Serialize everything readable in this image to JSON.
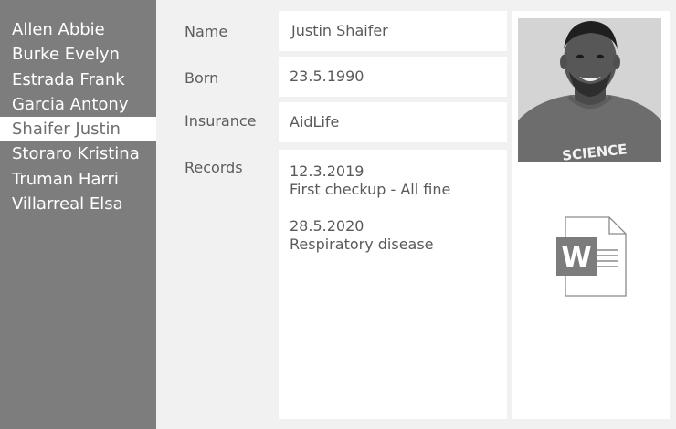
{
  "patients": [
    {
      "name": "Allen Abbie",
      "selected": false
    },
    {
      "name": "Burke Evelyn",
      "selected": false
    },
    {
      "name": "Estrada Frank",
      "selected": false
    },
    {
      "name": "Garcia Antony",
      "selected": false
    },
    {
      "name": "Shaifer Justin",
      "selected": true
    },
    {
      "name": "Storaro Kristina",
      "selected": false
    },
    {
      "name": "Truman Harri",
      "selected": false
    },
    {
      "name": "Villarreal Elsa",
      "selected": false
    }
  ],
  "labels": {
    "name": "Name",
    "born": "Born",
    "insurance": "Insurance",
    "records": "Records"
  },
  "values": {
    "name": "Justin Shaifer",
    "born": "23.5.1990",
    "insurance": "AidLife"
  },
  "records": [
    {
      "date": "12.3.2019",
      "note": "First checkup - All fine"
    },
    {
      "date": "28.5.2020",
      "note": "Respiratory disease"
    }
  ],
  "photo": {
    "shirt_text": "SCIENCE"
  },
  "document_icon": {
    "name": "word-document-icon",
    "letter": "W"
  }
}
